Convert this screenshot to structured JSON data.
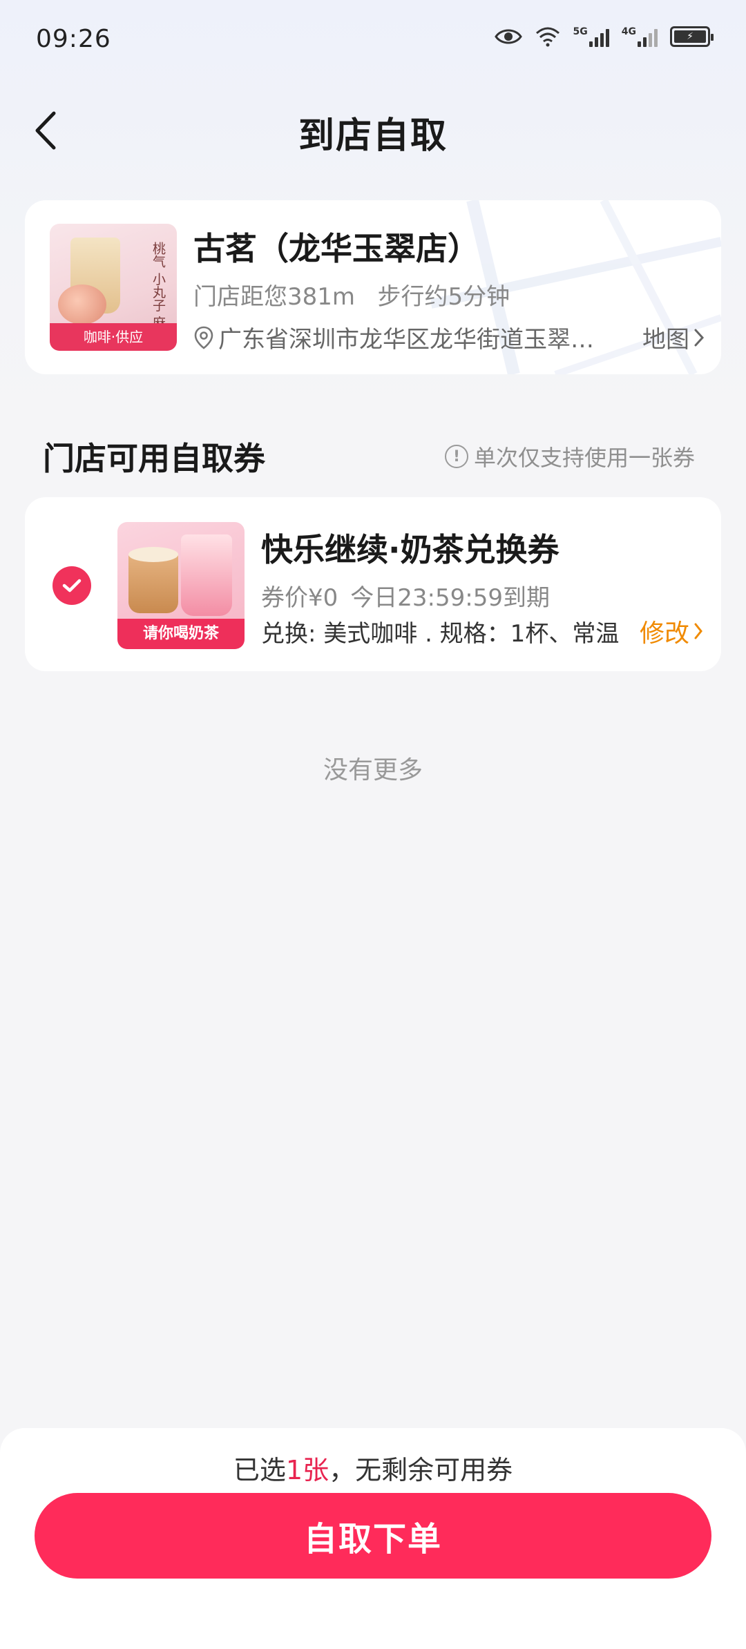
{
  "status_bar": {
    "time": "09:26",
    "net1": "5G",
    "net2": "4G",
    "icons": [
      "eye-icon",
      "wifi-icon",
      "signal-5g-icon",
      "signal-4g-icon",
      "battery-icon"
    ]
  },
  "nav": {
    "title": "到店自取",
    "back_icon": "back-arrow-icon"
  },
  "store": {
    "name": "古茗（龙华玉翠店）",
    "distance": "门店距您381m   步行约5分钟",
    "address": "广东省深圳市龙华区龙华街道玉翠社区",
    "map_label": "地图",
    "image_tag": "咖啡·供应",
    "image_brand_text": "桃气 小丸子 麻薯"
  },
  "coupons_section": {
    "title": "门店可用自取券",
    "note": "单次仅支持使用一张券"
  },
  "coupon": {
    "selected": true,
    "name": "快乐继续·奶茶兑换券",
    "price": "券价¥0",
    "expiry": "今日23:59:59到期",
    "exchange": "兑换: 美式咖啡 . 规格：1杯、常温",
    "modify_label": "修改",
    "image_tag": "请你喝奶茶"
  },
  "list_end_text": "没有更多",
  "bottom": {
    "summary_prefix": "已选",
    "summary_count": "1张",
    "summary_suffix": "，无剩余可用券",
    "submit_label": "自取下单"
  },
  "colors": {
    "accent": "#ff2b5a",
    "link_orange": "#f08a00",
    "check_red": "#f0325b"
  }
}
